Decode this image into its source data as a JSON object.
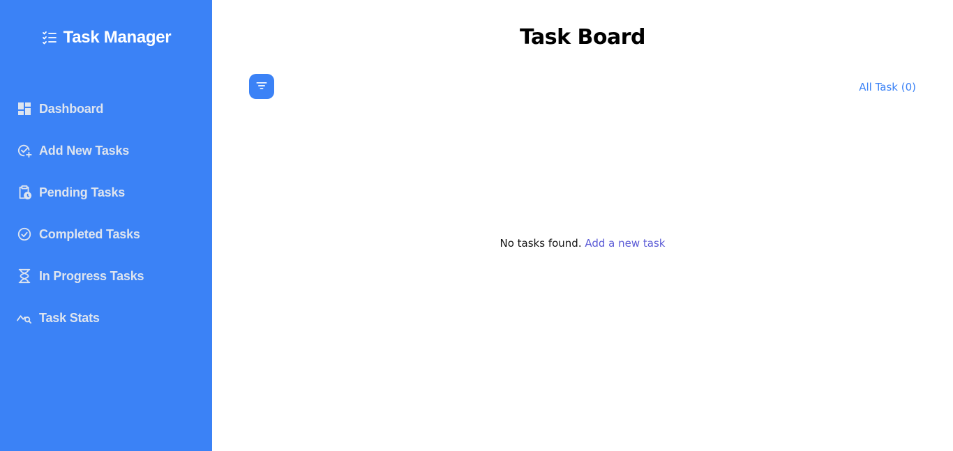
{
  "sidebar": {
    "brand": {
      "icon": "checklist-icon",
      "title": "Task Manager"
    },
    "items": [
      {
        "icon": "dashboard-icon",
        "label": "Dashboard"
      },
      {
        "icon": "circle-check-plus-icon",
        "label": "Add New Tasks"
      },
      {
        "icon": "clipboard-clock-icon",
        "label": "Pending Tasks"
      },
      {
        "icon": "circle-check-icon",
        "label": "Completed Tasks"
      },
      {
        "icon": "hourglass-icon",
        "label": "In Progress Tasks"
      },
      {
        "icon": "chart-search-icon",
        "label": "Task Stats"
      }
    ]
  },
  "main": {
    "title": "Task Board",
    "filter_icon": "filter-icon",
    "all_task_label": "All Task (0)",
    "empty_text": "No tasks found.",
    "empty_link": "Add a new task"
  },
  "colors": {
    "primary": "#3b82f6",
    "sidebar_text": "#dde4ef",
    "link": "#5b5bd6"
  }
}
